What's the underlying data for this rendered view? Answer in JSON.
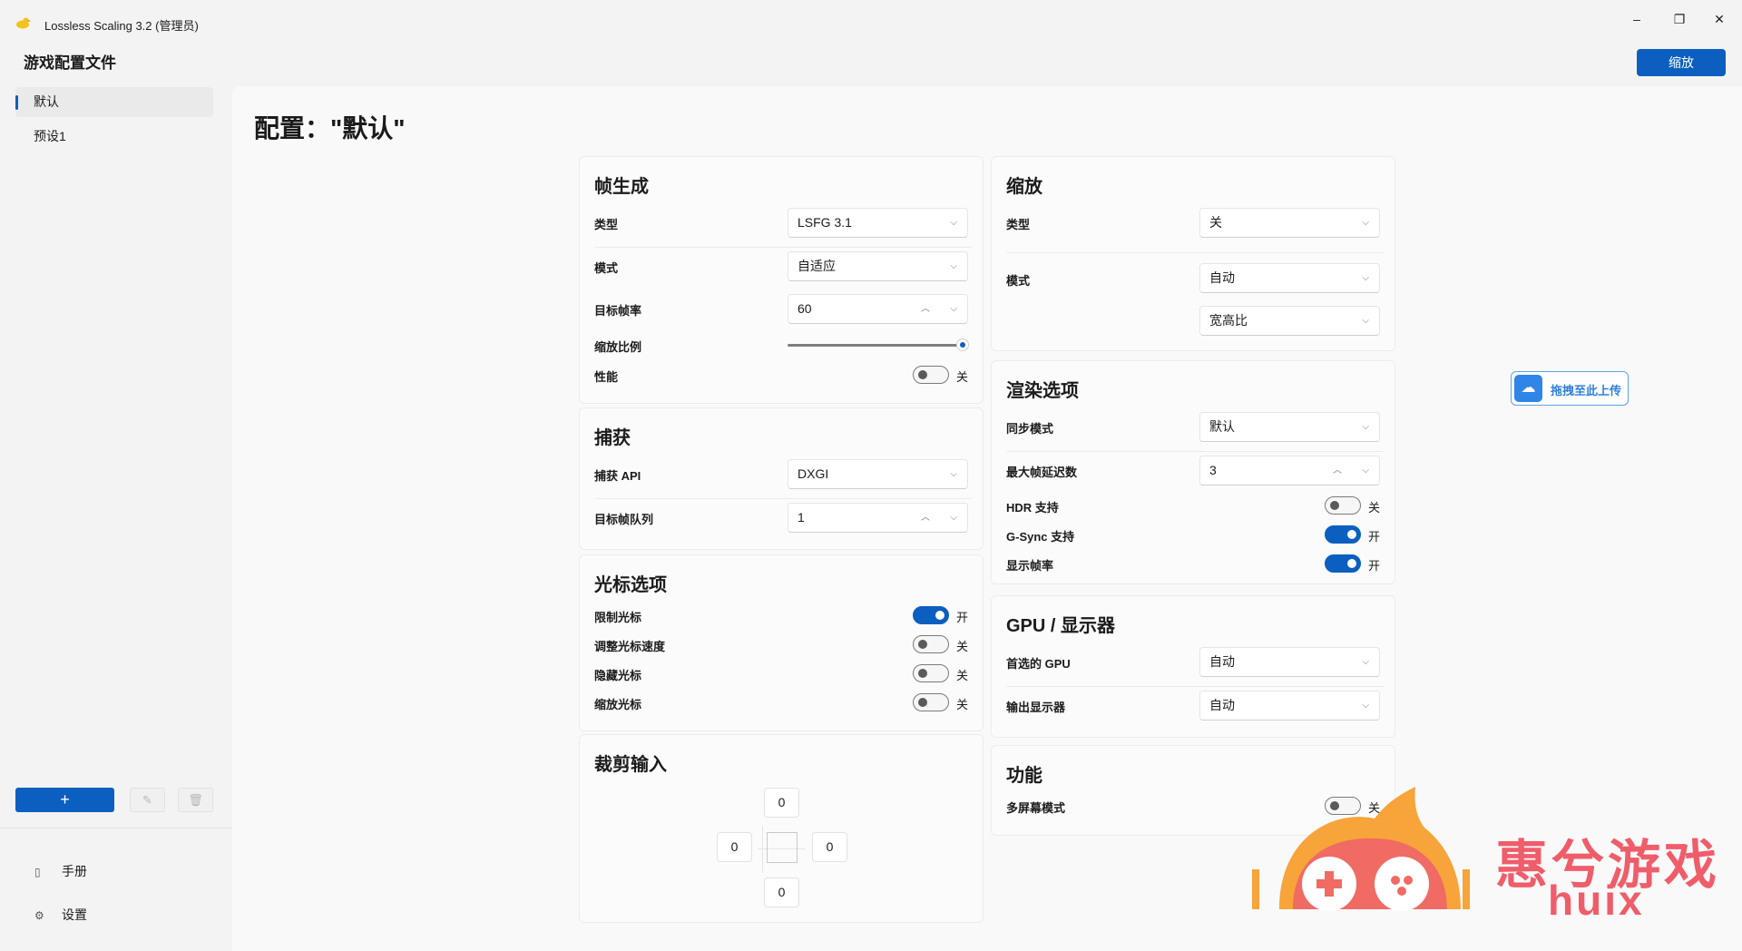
{
  "window": {
    "title": "Lossless Scaling 3.2 (管理员)",
    "minimize": "–",
    "restore": "❐",
    "close": "✕",
    "scale_button": "缩放"
  },
  "sidebar": {
    "title": "游戏配置文件",
    "profiles": [
      "默认",
      "预设1"
    ],
    "add_label": "+",
    "edit_icon": "✎",
    "delete_icon": "🗑",
    "footer": [
      {
        "icon": "▯",
        "label": "手册"
      },
      {
        "icon": "⚙",
        "label": "设置"
      }
    ]
  },
  "page_title": "配置：\"默认\"",
  "frame_gen": {
    "title": "帧生成",
    "type_label": "类型",
    "type_value": "LSFG 3.1",
    "mode_label": "模式",
    "mode_value": "自适应",
    "target_label": "目标帧率",
    "target_value": "60",
    "scale_label": "缩放比例",
    "scale_level": 1.0,
    "perf_label": "性能",
    "perf_state": "关"
  },
  "capture": {
    "title": "捕获",
    "api_label": "捕获 API",
    "api_value": "DXGI",
    "queue_label": "目标帧队列",
    "queue_value": "1"
  },
  "cursor": {
    "title": "光标选项",
    "items": [
      {
        "label": "限制光标",
        "state": "开"
      },
      {
        "label": "调整光标速度",
        "state": "关"
      },
      {
        "label": "隐藏光标",
        "state": "关"
      },
      {
        "label": "缩放光标",
        "state": "关"
      }
    ]
  },
  "crop": {
    "title": "裁剪输入",
    "top": "0",
    "left": "0",
    "right": "0",
    "bottom": "0"
  },
  "scaling": {
    "title": "缩放",
    "type_label": "类型",
    "type_value": "关",
    "mode_label": "模式",
    "mode_value": "自动",
    "aspect_value": "宽高比"
  },
  "render": {
    "title": "渲染选项",
    "sync_label": "同步模式",
    "sync_value": "默认",
    "latency_label": "最大帧延迟数",
    "latency_value": "3",
    "hdr_label": "HDR 支持",
    "hdr_state": "关",
    "gsync_label": "G-Sync 支持",
    "gsync_state": "开",
    "fps_label": "显示帧率",
    "fps_state": "开"
  },
  "gpu": {
    "title": "GPU / 显示器",
    "gpu_label": "首选的 GPU",
    "gpu_value": "自动",
    "display_label": "输出显示器",
    "display_value": "自动"
  },
  "features": {
    "title": "功能",
    "multi_label": "多屏幕模式",
    "multi_state": "关"
  },
  "upload_widget": {
    "icon": "☁",
    "label": "拖拽至此上传"
  },
  "watermark": {
    "text": "惠兮游戏",
    "sub": "huix"
  },
  "colors": {
    "accent": "#0a5fc0",
    "watermark": "#f05d6a"
  }
}
